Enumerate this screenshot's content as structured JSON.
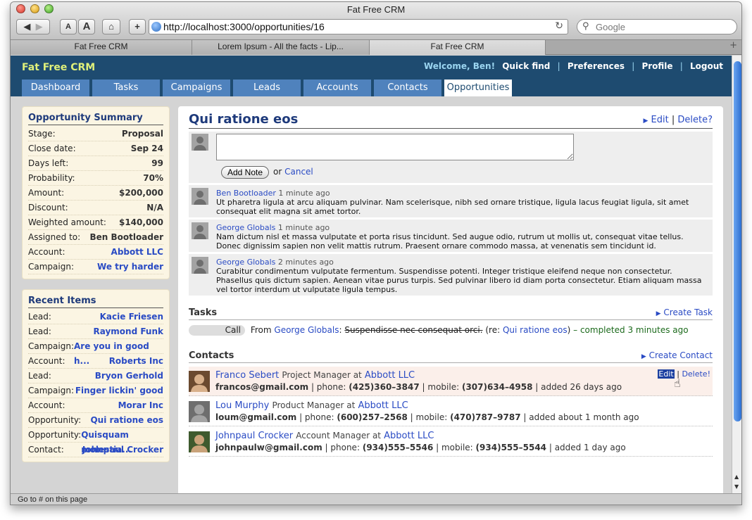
{
  "browser": {
    "window_title": "Fat Free CRM",
    "url": "http://localhost:3000/opportunities/16",
    "search_placeholder": "Google",
    "font_small": "A",
    "font_large": "A",
    "add": "+",
    "tabs": [
      {
        "label": "Fat Free CRM",
        "active": false
      },
      {
        "label": "Lorem Ipsum - All the facts - Lip...",
        "active": false
      },
      {
        "label": "Fat Free CRM",
        "active": true
      }
    ],
    "status": "Go to # on this page"
  },
  "app": {
    "brand": "Fat Free CRM",
    "welcome": "Welcome, Ben!",
    "links": [
      "Quick find",
      "Preferences",
      "Profile",
      "Logout"
    ],
    "tabs": [
      "Dashboard",
      "Tasks",
      "Campaigns",
      "Leads",
      "Accounts",
      "Contacts",
      "Opportunities"
    ],
    "active_tab": "Opportunities"
  },
  "summary": {
    "title": "Opportunity Summary",
    "rows": [
      {
        "k": "Stage:",
        "v": "Proposal"
      },
      {
        "k": "Close date:",
        "v": "Sep 24"
      },
      {
        "k": "Days left:",
        "v": "99"
      },
      {
        "k": "Probability:",
        "v": "70%"
      },
      {
        "k": "Amount:",
        "v": "$200,000"
      },
      {
        "k": "Discount:",
        "v": "N/A"
      },
      {
        "k": "Weighted amount:",
        "v": "$140,000"
      },
      {
        "k": "Assigned to:",
        "v": "Ben Bootloader"
      },
      {
        "k": "Account:",
        "v": "Abbott LLC"
      },
      {
        "k": "Campaign:",
        "v": "We try harder"
      }
    ]
  },
  "recent": {
    "title": "Recent Items",
    "rows": [
      {
        "k": "Lead:",
        "v": "Kacie Friesen"
      },
      {
        "k": "Lead:",
        "v": "Raymond Funk"
      },
      {
        "k": "Campaign:",
        "v": "Are you in good h..."
      },
      {
        "k": "Account:",
        "v": "Roberts Inc"
      },
      {
        "k": "Lead:",
        "v": "Bryon Gerhold"
      },
      {
        "k": "Campaign:",
        "v": "Finger lickin' good"
      },
      {
        "k": "Account:",
        "v": "Morar Inc"
      },
      {
        "k": "Opportunity:",
        "v": "Qui ratione eos"
      },
      {
        "k": "Opportunity:",
        "v": "Quisquam molestia..."
      },
      {
        "k": "Contact:",
        "v": "Johnpaul Crocker"
      }
    ]
  },
  "opportunity": {
    "name": "Qui ratione eos",
    "edit": "Edit",
    "delete": "Delete?",
    "add_note": "Add Note",
    "or": "or",
    "cancel": "Cancel"
  },
  "comments": [
    {
      "author": "Ben Bootloader",
      "time": "1 minute ago",
      "text": "Ut pharetra ligula at arcu aliquam pulvinar. Nam scelerisque, nibh sed ornare tristique, ligula lacus feugiat ligula, sit amet consequat elit magna sit amet tortor."
    },
    {
      "author": "George Globals",
      "time": "1 minute ago",
      "text": "Nam dictum nisl et massa vulputate et porta risus tincidunt. Sed augue odio, rutrum ut mollis ut, consequat vitae tellus. Donec dignissim sapien non velit mattis rutrum. Praesent ornare commodo massa, at venenatis sem tincidunt id."
    },
    {
      "author": "George Globals",
      "time": "2 minutes ago",
      "text": "Curabitur condimentum vulputate fermentum. Suspendisse potenti. Integer tristique eleifend neque non consectetur. Phasellus quis dictum sapien. Aenean vitae purus turpis. Sed pulvinar libero id diam porta consectetur. Etiam aliquam massa vel tortor interdum ut vulputate ligula tempus."
    }
  ],
  "tasks": {
    "title": "Tasks",
    "create": "Create Task",
    "items": [
      {
        "type": "Call",
        "from_label": "From",
        "from": "George Globals",
        "subject": "Suspendisse nec consequat orci.",
        "re_open": "(re:",
        "re": "Qui ratione eos",
        "re_close": ")",
        "status": "– completed",
        "time": "3 minutes ago"
      }
    ]
  },
  "contacts": {
    "title": "Contacts",
    "create": "Create Contact",
    "items": [
      {
        "name": "Franco Sebert",
        "title": "Project Manager at",
        "company": "Abbott LLC",
        "email": "francos@gmail.com",
        "phone": "(425)360–3847",
        "mobile": "(307)634–4958",
        "added": "added 26 days ago",
        "edit": "Edit",
        "delete": "Delete!"
      },
      {
        "name": "Lou Murphy",
        "title": "Product Manager at",
        "company": "Abbott LLC",
        "email": "loum@gmail.com",
        "phone": "(600)257–2568",
        "mobile": "(470)787–9787",
        "added": "added about 1 month ago"
      },
      {
        "name": "Johnpaul Crocker",
        "title": "Account Manager at",
        "company": "Abbott LLC",
        "email": "johnpaulw@gmail.com",
        "phone": "(934)555–5546",
        "mobile": "(934)555–5544",
        "added": "added 1 day ago"
      }
    ],
    "phone_label": "phone:",
    "mobile_label": "mobile:"
  }
}
